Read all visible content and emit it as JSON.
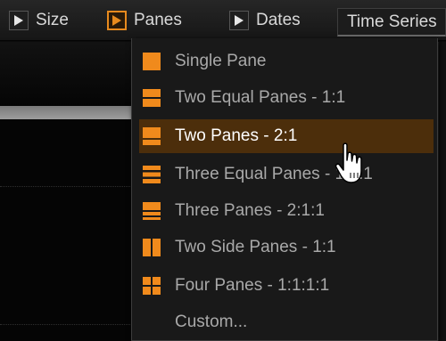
{
  "toolbar": {
    "size_label": "Size",
    "panes_label": "Panes",
    "dates_label": "Dates",
    "tab_label": "Time Series"
  },
  "menu": {
    "items": [
      {
        "label": "Single Pane",
        "icon": "single-pane-icon"
      },
      {
        "label": "Two Equal Panes - 1:1",
        "icon": "two-equal-panes-icon"
      },
      {
        "label": "Two Panes - 2:1",
        "icon": "two-panes-2-1-icon",
        "highlighted": true
      },
      {
        "label": "Three Equal Panes - 1:1:1",
        "icon": "three-equal-panes-icon"
      },
      {
        "label": "Three Panes - 2:1:1",
        "icon": "three-panes-2-1-1-icon"
      },
      {
        "label": "Two Side Panes - 1:1",
        "icon": "two-side-panes-icon"
      },
      {
        "label": "Four Panes - 1:1:1:1",
        "icon": "four-panes-icon"
      },
      {
        "label": "Custom...",
        "icon": ""
      }
    ]
  },
  "colors": {
    "accent": "#e78a1e",
    "highlight": "#4c2e0b",
    "menu_bg": "#191919"
  }
}
